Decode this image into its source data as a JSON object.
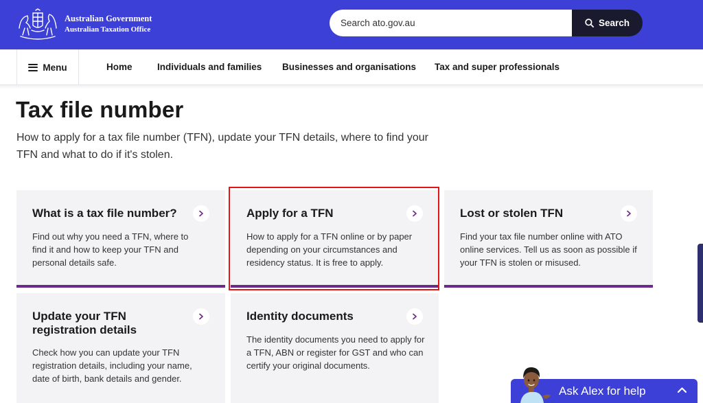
{
  "header": {
    "logo_line1": "Australian Government",
    "logo_line2": "Australian Taxation Office",
    "search_placeholder": "Search ato.gov.au",
    "search_button": "Search"
  },
  "nav": {
    "menu_label": "Menu",
    "links": [
      "Home",
      "Individuals and families",
      "Businesses and organisations",
      "Tax and super professionals"
    ]
  },
  "page": {
    "title": "Tax file number",
    "intro": "How to apply for a tax file number (TFN), update your TFN details, where to find your TFN and what to do if it's stolen."
  },
  "cards": [
    {
      "title": "What is a tax file number?",
      "desc": "Find out why you need a TFN, where to find it and how to keep your TFN and personal details safe."
    },
    {
      "title": "Apply for a TFN",
      "desc": "How to apply for a TFN online or by paper depending on your circumstances and residency status. It is free to apply."
    },
    {
      "title": "Lost or stolen TFN",
      "desc": "Find your tax file number online with ATO online services. Tell us as soon as possible if your TFN is stolen or misused."
    },
    {
      "title": "Update your TFN registration details",
      "desc": "Check how you can update your TFN registration details, including your name, date of birth, bank details and gender."
    },
    {
      "title": "Identity documents",
      "desc": "The identity documents you need to apply for a TFN, ABN or register for GST and who can certify your original documents."
    }
  ],
  "chat": {
    "label": "Ask Alex for help"
  },
  "colors": {
    "brand_blue": "#3d40d6",
    "card_accent": "#6b2a8a",
    "highlight_red": "#e01515"
  }
}
